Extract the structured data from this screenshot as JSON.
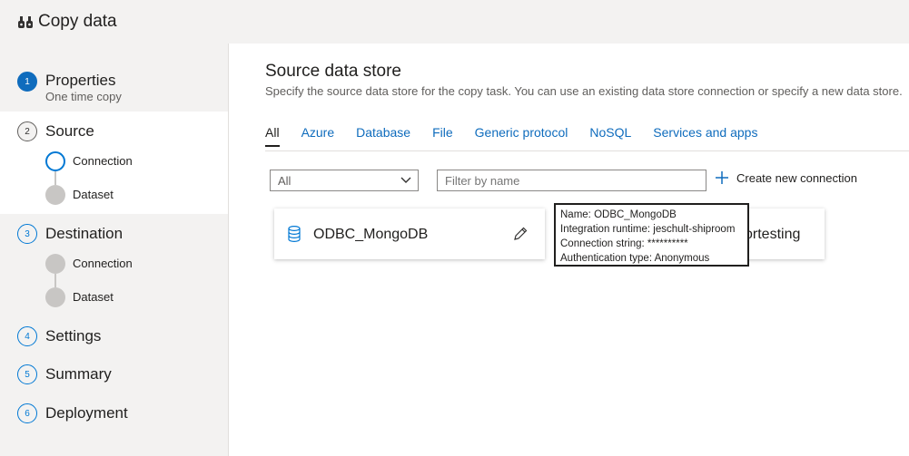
{
  "app": {
    "title": "Copy data",
    "icon": "copy-data-icon"
  },
  "steps": [
    {
      "number": "1",
      "label": "Properties",
      "sub": "One time copy"
    },
    {
      "number": "2",
      "label": "Source",
      "substeps": [
        "Connection",
        "Dataset"
      ]
    },
    {
      "number": "3",
      "label": "Destination",
      "substeps": [
        "Connection",
        "Dataset"
      ]
    },
    {
      "number": "4",
      "label": "Settings"
    },
    {
      "number": "5",
      "label": "Summary"
    },
    {
      "number": "6",
      "label": "Deployment"
    }
  ],
  "main": {
    "title": "Source data store",
    "description": "Specify the source data store for the copy task. You can use an existing data store connection or specify a new data store.",
    "tabs": [
      "All",
      "Azure",
      "Database",
      "File",
      "Generic protocol",
      "NoSQL",
      "Services and apps"
    ],
    "filter_dropdown": {
      "value": "All"
    },
    "filter_input": {
      "placeholder": "Filter by name"
    },
    "create_button": "Create new connection",
    "cards": [
      {
        "name": "ODBC_MongoDB",
        "icon": "database-icon"
      },
      {
        "name": "ortesting",
        "icon": "database-icon"
      }
    ],
    "tooltip": {
      "name": "Name: ODBC_MongoDB",
      "runtime": "Integration runtime: jeschult-shiproom",
      "connection": "Connection string: **********",
      "auth": "Authentication type: Anonymous"
    }
  },
  "colors": {
    "accent": "#0f6cbd",
    "blue": "#0078d4",
    "sidebar_bg": "#f3f2f1"
  }
}
